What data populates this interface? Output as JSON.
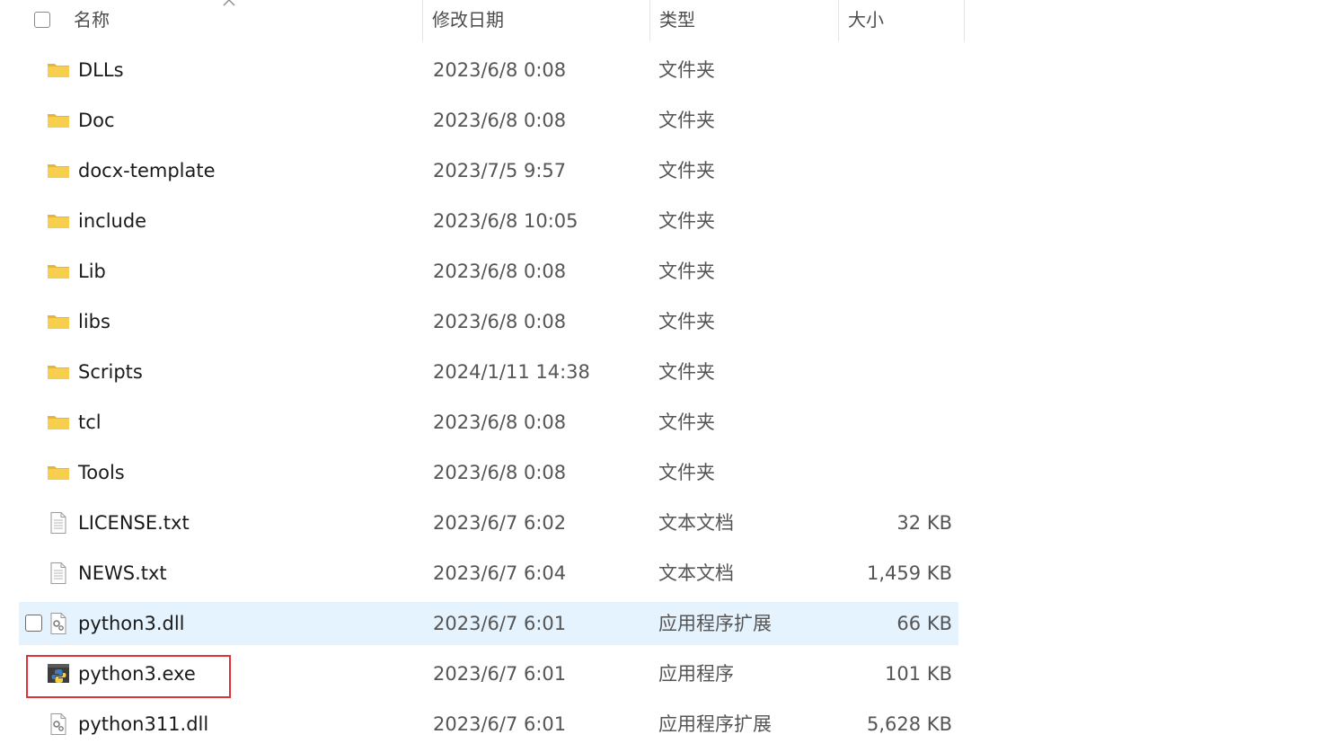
{
  "header": {
    "name_label": "名称",
    "date_label": "修改日期",
    "type_label": "类型",
    "size_label": "大小",
    "sort_icon": "chevron-up-icon"
  },
  "files": [
    {
      "name": "DLLs",
      "date": "2023/6/8 0:08",
      "type": "文件夹",
      "size": "",
      "icon": "folder-icon"
    },
    {
      "name": "Doc",
      "date": "2023/6/8 0:08",
      "type": "文件夹",
      "size": "",
      "icon": "folder-icon"
    },
    {
      "name": "docx-template",
      "date": "2023/7/5 9:57",
      "type": "文件夹",
      "size": "",
      "icon": "folder-icon"
    },
    {
      "name": "include",
      "date": "2023/6/8 10:05",
      "type": "文件夹",
      "size": "",
      "icon": "folder-icon"
    },
    {
      "name": "Lib",
      "date": "2023/6/8 0:08",
      "type": "文件夹",
      "size": "",
      "icon": "folder-icon"
    },
    {
      "name": "libs",
      "date": "2023/6/8 0:08",
      "type": "文件夹",
      "size": "",
      "icon": "folder-icon"
    },
    {
      "name": "Scripts",
      "date": "2024/1/11 14:38",
      "type": "文件夹",
      "size": "",
      "icon": "folder-icon"
    },
    {
      "name": "tcl",
      "date": "2023/6/8 0:08",
      "type": "文件夹",
      "size": "",
      "icon": "folder-icon"
    },
    {
      "name": "Tools",
      "date": "2023/6/8 0:08",
      "type": "文件夹",
      "size": "",
      "icon": "folder-icon"
    },
    {
      "name": "LICENSE.txt",
      "date": "2023/6/7 6:02",
      "type": "文本文档",
      "size": "32 KB",
      "icon": "text-file-icon"
    },
    {
      "name": "NEWS.txt",
      "date": "2023/6/7 6:04",
      "type": "文本文档",
      "size": "1,459 KB",
      "icon": "text-file-icon"
    },
    {
      "name": "python3.dll",
      "date": "2023/6/7 6:01",
      "type": "应用程序扩展",
      "size": "66 KB",
      "icon": "dll-file-icon"
    },
    {
      "name": "python3.exe",
      "date": "2023/6/7 6:01",
      "type": "应用程序",
      "size": "101 KB",
      "icon": "python-exe-icon"
    },
    {
      "name": "python311.dll",
      "date": "2023/6/7 6:01",
      "type": "应用程序扩展",
      "size": "5,628 KB",
      "icon": "dll-file-icon"
    }
  ],
  "state": {
    "hovered_file": "python3.dll",
    "highlighted_file": "python3.exe"
  },
  "colors": {
    "hover_bg": "#e5f3ff",
    "highlight_border": "#e0323a",
    "folder": "#f8cf4c"
  }
}
